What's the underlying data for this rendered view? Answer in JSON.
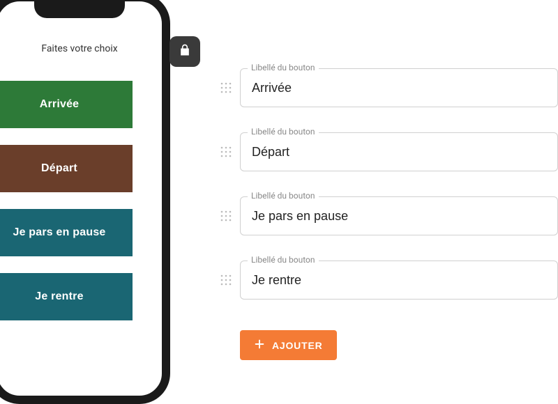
{
  "phone": {
    "title": "Faites votre choix",
    "buttons": [
      {
        "label": "Arrivée",
        "color": "green"
      },
      {
        "label": "Départ",
        "color": "brown"
      },
      {
        "label": "Je pars en pause",
        "color": "teal"
      },
      {
        "label": "Je rentre",
        "color": "teal"
      }
    ]
  },
  "fields_label": "Libellé du bouton",
  "fields": [
    {
      "value": "Arrivée"
    },
    {
      "value": "Départ"
    },
    {
      "value": "Je pars en pause"
    },
    {
      "value": "Je rentre"
    }
  ],
  "add_button": {
    "label": "AJOUTER"
  }
}
